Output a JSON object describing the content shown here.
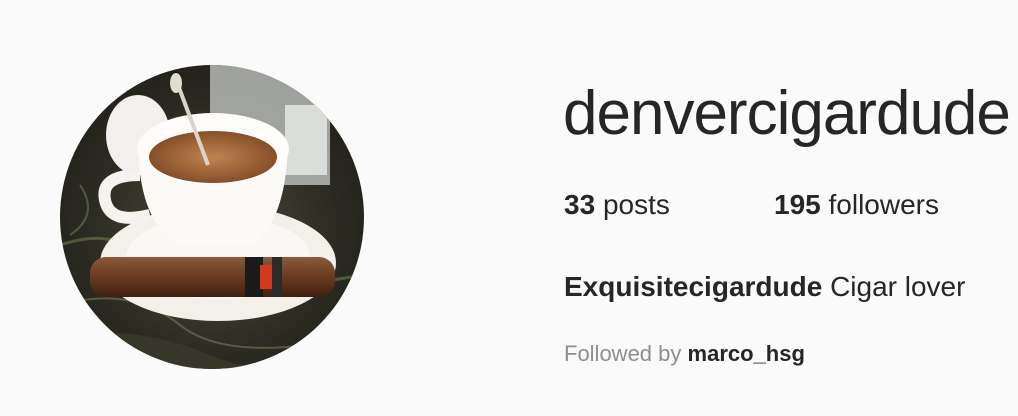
{
  "profile": {
    "username": "denvercigardude",
    "avatar_alt": "profile photo: coffee cup with a cigar on a saucer",
    "stats": {
      "posts_count": "33",
      "posts_label": "posts",
      "followers_count": "195",
      "followers_label": "followers"
    },
    "bio": {
      "full_name": "Exquisitecigardude",
      "text": "Cigar lover"
    },
    "followed_by": {
      "prefix": "Followed by",
      "user": "marco_hsg"
    }
  },
  "colors": {
    "background": "#fafafa",
    "text_primary": "#262626",
    "text_secondary": "#8e8e8e"
  }
}
